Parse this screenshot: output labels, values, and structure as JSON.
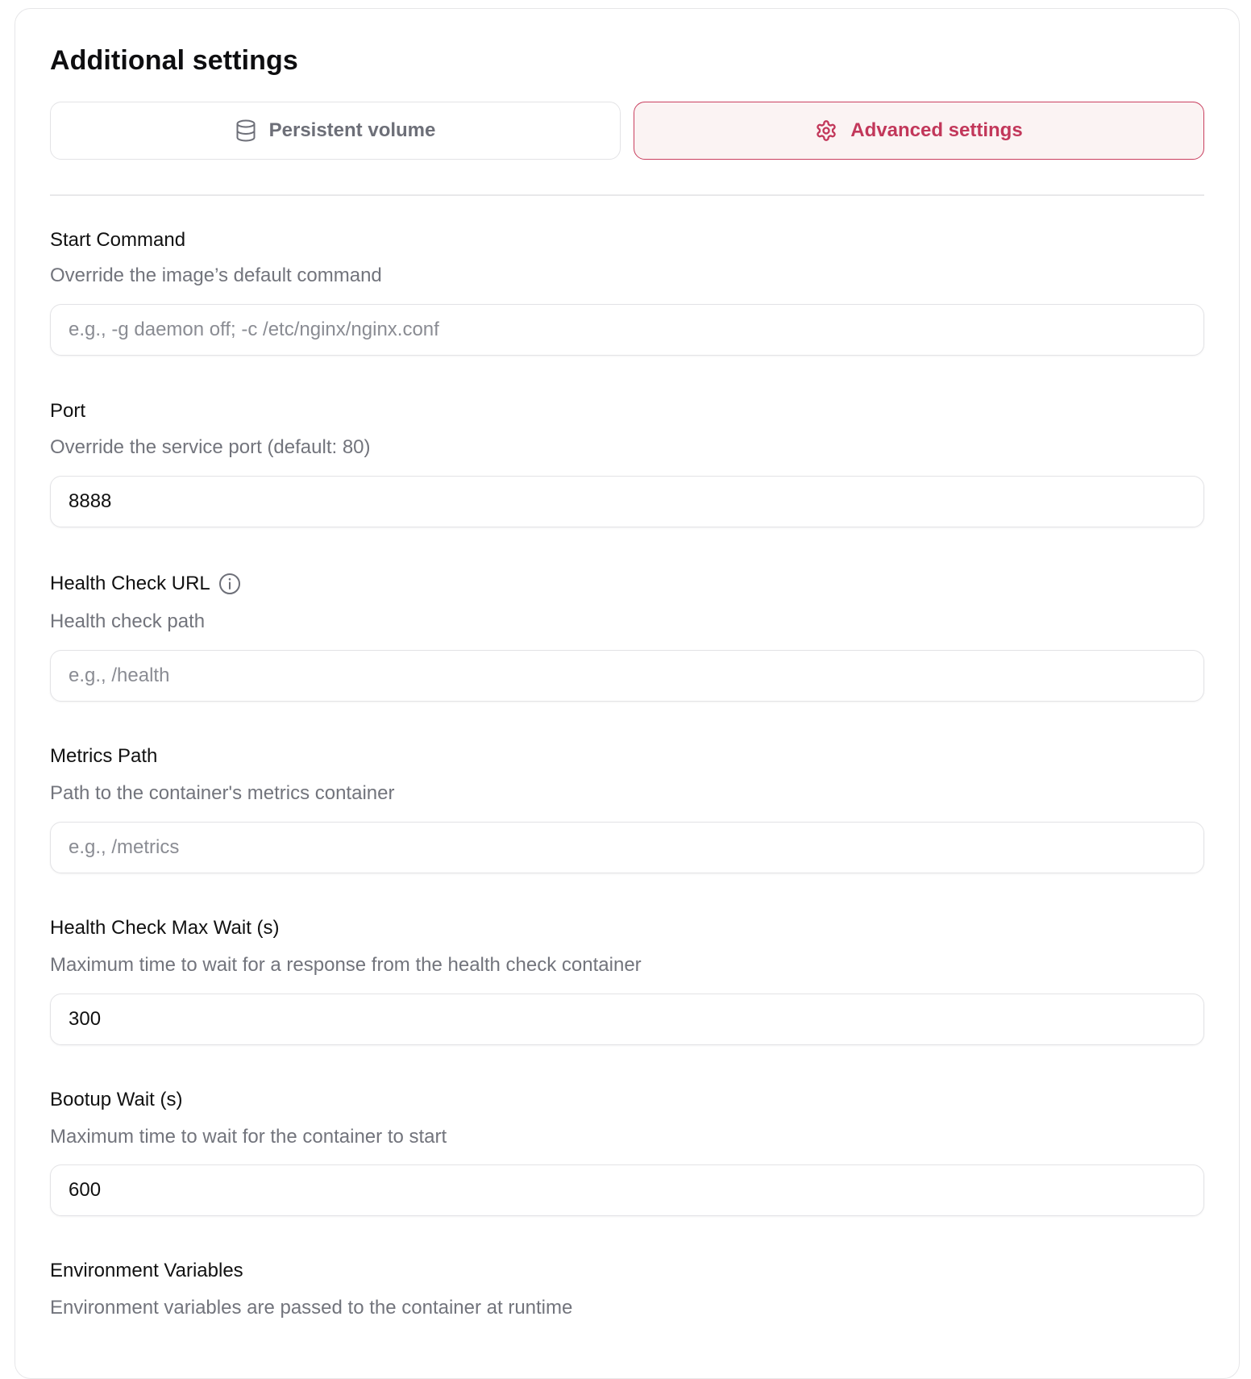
{
  "section": {
    "title": "Additional settings"
  },
  "tabs": [
    {
      "label": "Persistent volume",
      "icon": "database-icon",
      "active": false
    },
    {
      "label": "Advanced settings",
      "icon": "gear-icon",
      "active": true
    }
  ],
  "colors": {
    "accent": "#c2375a",
    "accent_bg": "#fbf3f3",
    "muted_text": "#72747c",
    "border": "#e3e3e6"
  },
  "fields": {
    "start_command": {
      "label": "Start Command",
      "description": "Override the image’s default command",
      "value": "",
      "placeholder": "e.g., -g daemon off; -c /etc/nginx/nginx.conf"
    },
    "port": {
      "label": "Port",
      "description": "Override the service port (default: 80)",
      "value": "8888",
      "placeholder": ""
    },
    "health_check_url": {
      "label": "Health Check URL",
      "info_icon": "info-icon",
      "description": "Health check path",
      "value": "",
      "placeholder": "e.g., /health"
    },
    "metrics_path": {
      "label": "Metrics Path",
      "description": "Path to the container's metrics container",
      "value": "",
      "placeholder": "e.g., /metrics"
    },
    "health_check_max_wait": {
      "label": "Health Check Max Wait (s)",
      "description": "Maximum time to wait for a response from the health check container",
      "value": "300",
      "placeholder": ""
    },
    "bootup_wait": {
      "label": "Bootup Wait (s)",
      "description": "Maximum time to wait for the container to start",
      "value": "600",
      "placeholder": ""
    },
    "environment_variables": {
      "label": "Environment Variables",
      "description": "Environment variables are passed to the container at runtime"
    }
  }
}
